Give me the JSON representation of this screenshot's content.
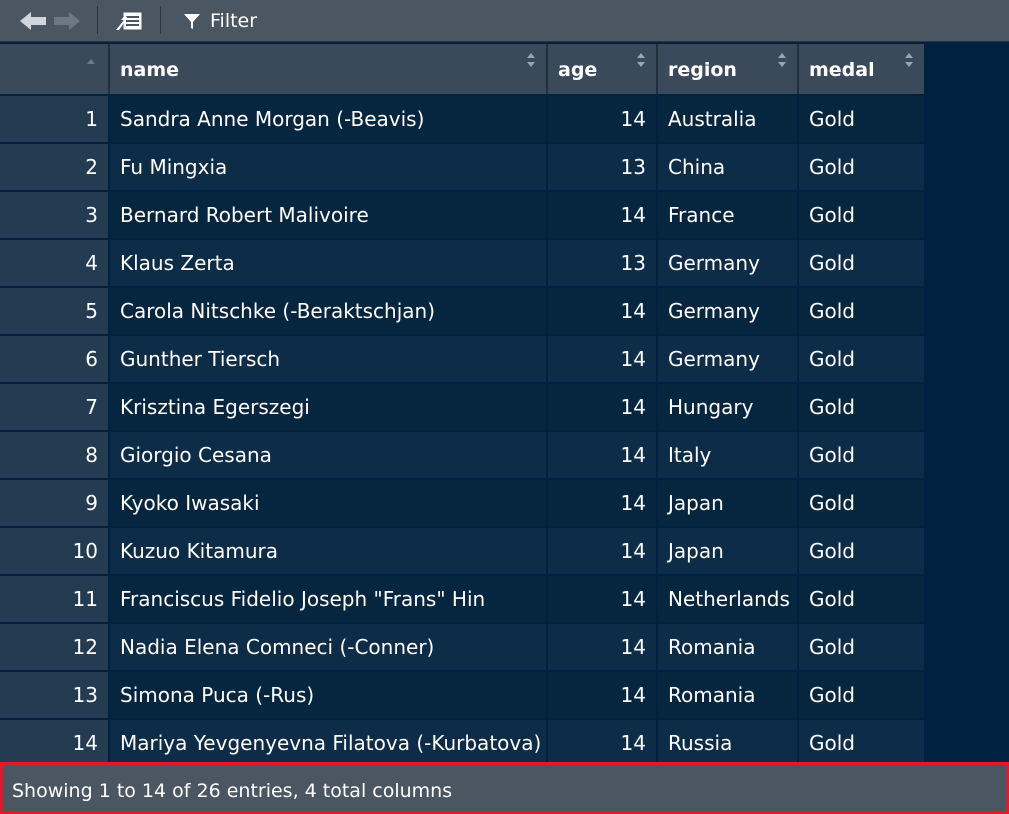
{
  "toolbar": {
    "filter_label": "Filter",
    "icons": [
      "back-arrow-icon",
      "forward-arrow-icon",
      "export-icon",
      "filter-icon"
    ]
  },
  "table": {
    "columns": [
      "name",
      "age",
      "region",
      "medal"
    ],
    "rows": [
      {
        "idx": "1",
        "name": "Sandra Anne Morgan (-Beavis)",
        "age": "14",
        "region": "Australia",
        "medal": "Gold"
      },
      {
        "idx": "2",
        "name": "Fu Mingxia",
        "age": "13",
        "region": "China",
        "medal": "Gold"
      },
      {
        "idx": "3",
        "name": "Bernard Robert Malivoire",
        "age": "14",
        "region": "France",
        "medal": "Gold"
      },
      {
        "idx": "4",
        "name": "Klaus Zerta",
        "age": "13",
        "region": "Germany",
        "medal": "Gold"
      },
      {
        "idx": "5",
        "name": "Carola Nitschke (-Beraktschjan)",
        "age": "14",
        "region": "Germany",
        "medal": "Gold"
      },
      {
        "idx": "6",
        "name": "Gunther Tiersch",
        "age": "14",
        "region": "Germany",
        "medal": "Gold"
      },
      {
        "idx": "7",
        "name": "Krisztina Egerszegi",
        "age": "14",
        "region": "Hungary",
        "medal": "Gold"
      },
      {
        "idx": "8",
        "name": "Giorgio Cesana",
        "age": "14",
        "region": "Italy",
        "medal": "Gold"
      },
      {
        "idx": "9",
        "name": "Kyoko Iwasaki",
        "age": "14",
        "region": "Japan",
        "medal": "Gold"
      },
      {
        "idx": "10",
        "name": "Kuzuo Kitamura",
        "age": "14",
        "region": "Japan",
        "medal": "Gold"
      },
      {
        "idx": "11",
        "name": "Franciscus Fidelio Joseph \"Frans\" Hin",
        "age": "14",
        "region": "Netherlands",
        "medal": "Gold"
      },
      {
        "idx": "12",
        "name": "Nadia Elena Comneci (-Conner)",
        "age": "14",
        "region": "Romania",
        "medal": "Gold"
      },
      {
        "idx": "13",
        "name": "Simona Puca (-Rus)",
        "age": "14",
        "region": "Romania",
        "medal": "Gold"
      },
      {
        "idx": "14",
        "name": "Mariya Yevgenyevna Filatova (-Kurbatova)",
        "age": "14",
        "region": "Russia",
        "medal": "Gold"
      }
    ]
  },
  "status": {
    "text": "Showing 1 to 14 of 26 entries, 4 total columns"
  },
  "colors": {
    "background": "#002240",
    "toolbar": "#4a5662",
    "header": "#3a4a5a",
    "highlight_border": "#e0192e"
  }
}
